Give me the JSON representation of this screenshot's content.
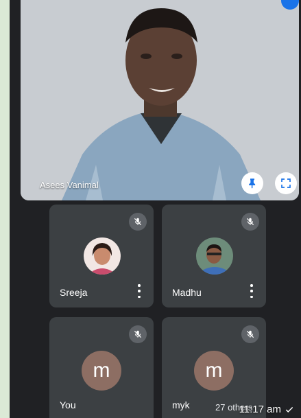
{
  "main_speaker": {
    "name": "Asees Vanimal",
    "pin_icon": "pin-icon",
    "fullscreen_icon": "fullscreen-icon"
  },
  "participants": [
    {
      "name": "Sreeja",
      "avatar": "photo"
    },
    {
      "name": "Madhu",
      "avatar": "photo"
    },
    {
      "name": "You",
      "avatar_letter": "m"
    },
    {
      "name": "myk",
      "avatar_letter": "m"
    }
  ],
  "others_chip": "27 others",
  "timestamp": "11:17 am",
  "colors": {
    "tile_bg": "#3c4043",
    "screen_bg": "#202124",
    "letter_avatar": "#8d6e63"
  }
}
